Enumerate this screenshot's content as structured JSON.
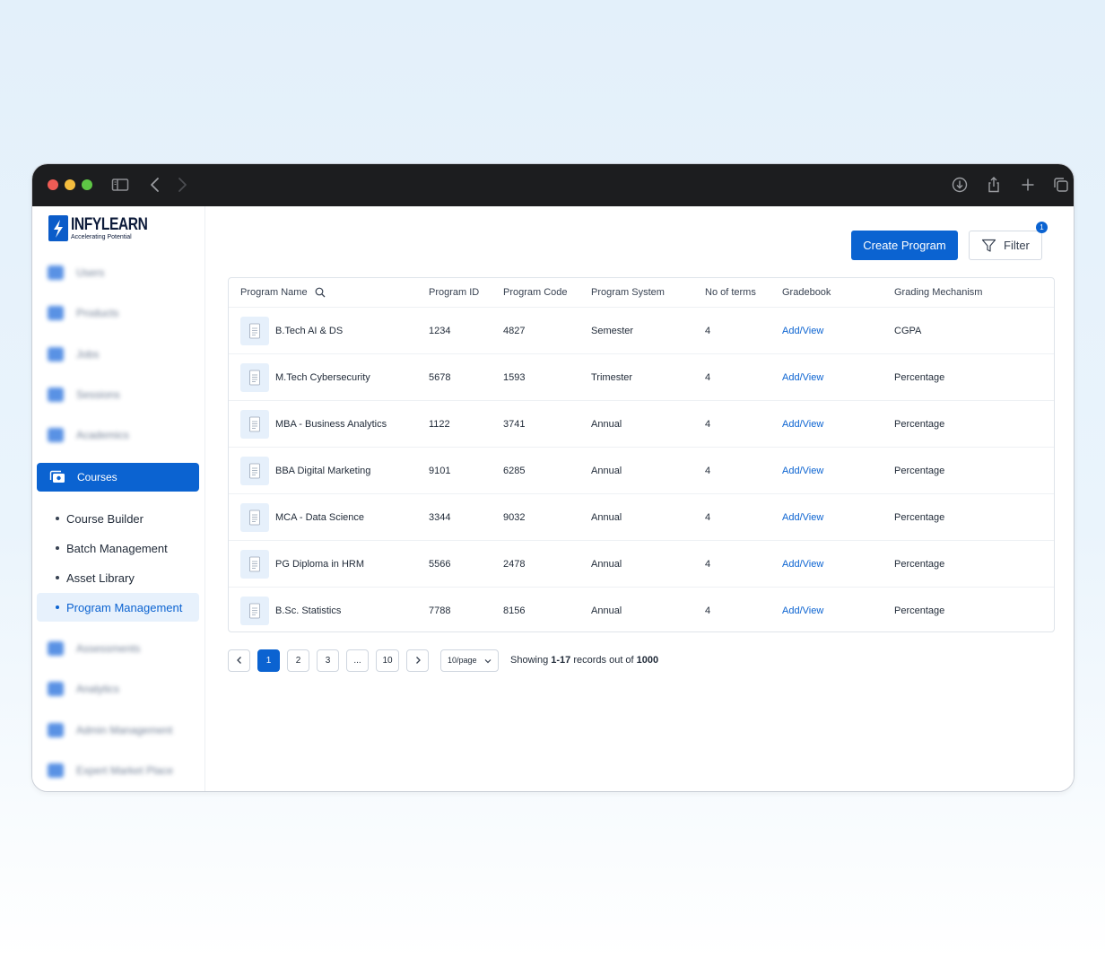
{
  "brand": {
    "name": "INFYLEARN",
    "tagline": "Accelerating Potential",
    "color": "#0b63d1"
  },
  "sidebar": {
    "blurred_items": [
      "Users",
      "Products",
      "Jobs",
      "Sessions",
      "Academics"
    ],
    "active_item": "Courses",
    "sub_items": [
      "Course Builder",
      "Batch Management",
      "Asset Library",
      "Program Management"
    ],
    "active_sub_item": "Program Management",
    "blurred_items_after": [
      "Assessments",
      "Analytics",
      "Admin Management",
      "Expert Market Place"
    ]
  },
  "toolbar": {
    "create_label": "Create Program",
    "filter_label": "Filter",
    "filter_count": "1"
  },
  "table": {
    "columns": [
      "Program Name",
      "Program ID",
      "Program Code",
      "Program System",
      "No of terms",
      "Gradebook",
      "Grading Mechanism"
    ],
    "rows": [
      {
        "name": "B.Tech AI & DS",
        "id": "1234",
        "code": "4827",
        "system": "Semester",
        "terms": "4",
        "gradebook": "Add/View",
        "mechanism": "CGPA"
      },
      {
        "name": "M.Tech Cybersecurity",
        "id": "5678",
        "code": "1593",
        "system": "Trimester",
        "terms": "4",
        "gradebook": "Add/View",
        "mechanism": "Percentage"
      },
      {
        "name": "MBA - Business Analytics",
        "id": "1122",
        "code": "3741",
        "system": "Annual",
        "terms": "4",
        "gradebook": "Add/View",
        "mechanism": "Percentage"
      },
      {
        "name": "BBA Digital Marketing",
        "id": "9101",
        "code": "6285",
        "system": "Annual",
        "terms": "4",
        "gradebook": "Add/View",
        "mechanism": "Percentage"
      },
      {
        "name": "MCA - Data Science",
        "id": "3344",
        "code": "9032",
        "system": "Annual",
        "terms": "4",
        "gradebook": "Add/View",
        "mechanism": "Percentage"
      },
      {
        "name": "PG Diploma in HRM",
        "id": "5566",
        "code": "2478",
        "system": "Annual",
        "terms": "4",
        "gradebook": "Add/View",
        "mechanism": "Percentage"
      },
      {
        "name": "B.Sc. Statistics",
        "id": "7788",
        "code": "8156",
        "system": "Annual",
        "terms": "4",
        "gradebook": "Add/View",
        "mechanism": "Percentage"
      }
    ]
  },
  "pagination": {
    "pages": [
      "1",
      "2",
      "3",
      "...",
      "10"
    ],
    "current_page": "1",
    "per_page": "10/page",
    "showing_prefix": "Showing ",
    "showing_range": "1-17",
    "showing_mid": " records out of ",
    "showing_total": "1000"
  }
}
